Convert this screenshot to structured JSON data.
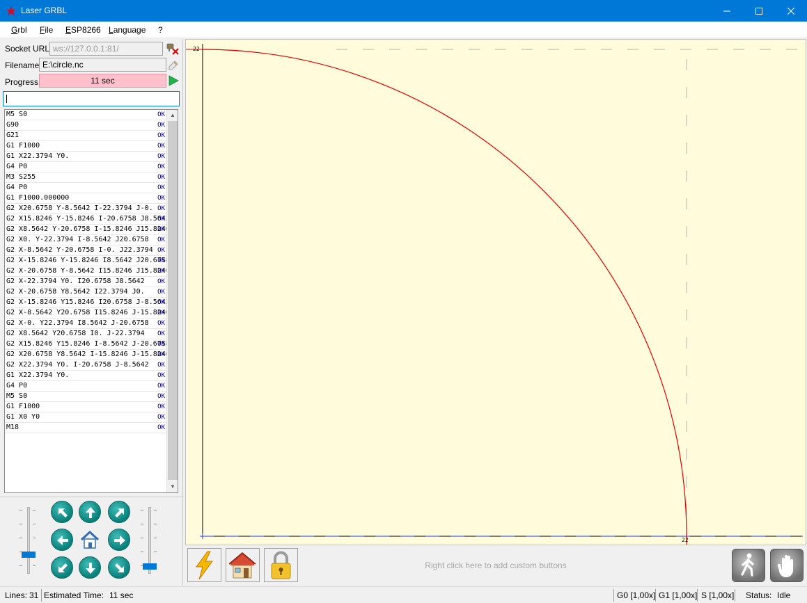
{
  "window": {
    "title": "Laser GRBL",
    "minimize": "—",
    "maximize": "☐",
    "close": "✕"
  },
  "menu": [
    "Grbl",
    "File",
    "ESP8266",
    "Language",
    "?"
  ],
  "left": {
    "socket_label": "Socket URL",
    "socket_value": "ws://127.0.0.1:81/",
    "filename_label": "Filename",
    "filename_value": "E:\\circle.nc",
    "progress_label": "Progress",
    "progress_text": "11 sec",
    "command_value": ""
  },
  "log": [
    {
      "cmd": "M5 S0",
      "status": "OK"
    },
    {
      "cmd": "G90",
      "status": "OK"
    },
    {
      "cmd": "G21",
      "status": "OK"
    },
    {
      "cmd": "G1 F1000",
      "status": "OK"
    },
    {
      "cmd": "G1 X22.3794 Y0.",
      "status": "OK"
    },
    {
      "cmd": "G4 P0",
      "status": "OK"
    },
    {
      "cmd": "M3 S255",
      "status": "OK"
    },
    {
      "cmd": "G4 P0",
      "status": "OK"
    },
    {
      "cmd": "G1 F1000.000000",
      "status": "OK"
    },
    {
      "cmd": "G2 X20.6758 Y-8.5642 I-22.3794 J-0.",
      "status": "OK"
    },
    {
      "cmd": "G2 X15.8246 Y-15.8246 I-20.6758 J8.5642",
      "status": "OK"
    },
    {
      "cmd": "G2 X8.5642 Y-20.6758 I-15.8246 J15.8246",
      "status": "OK"
    },
    {
      "cmd": "G2 X0. Y-22.3794 I-8.5642 J20.6758",
      "status": "OK"
    },
    {
      "cmd": "G2 X-8.5642 Y-20.6758 I-0. J22.3794",
      "status": "OK"
    },
    {
      "cmd": "G2 X-15.8246 Y-15.8246 I8.5642 J20.6758",
      "status": "OK"
    },
    {
      "cmd": "G2 X-20.6758 Y-8.5642 I15.8246 J15.8246",
      "status": "OK"
    },
    {
      "cmd": "G2 X-22.3794 Y0. I20.6758 J8.5642",
      "status": "OK"
    },
    {
      "cmd": "G2 X-20.6758 Y8.5642 I22.3794 J0.",
      "status": "OK"
    },
    {
      "cmd": "G2 X-15.8246 Y15.8246 I20.6758 J-8.5642",
      "status": "OK"
    },
    {
      "cmd": "G2 X-8.5642 Y20.6758 I15.8246 J-15.8246",
      "status": "OK"
    },
    {
      "cmd": "G2 X-0. Y22.3794 I8.5642 J-20.6758",
      "status": "OK"
    },
    {
      "cmd": "G2 X8.5642 Y20.6758 I0. J-22.3794",
      "status": "OK"
    },
    {
      "cmd": "G2 X15.8246 Y15.8246 I-8.5642 J-20.6758",
      "status": "OK"
    },
    {
      "cmd": "G2 X20.6758 Y8.5642 I-15.8246 J-15.8246",
      "status": "OK"
    },
    {
      "cmd": "G2 X22.3794 Y0. I-20.6758 J-8.5642",
      "status": "OK"
    },
    {
      "cmd": "G1 X22.3794 Y0.",
      "status": "OK"
    },
    {
      "cmd": "G4 P0",
      "status": "OK"
    },
    {
      "cmd": "M5 S0",
      "status": "OK"
    },
    {
      "cmd": "G1 F1000",
      "status": "OK"
    },
    {
      "cmd": "G1 X0 Y0",
      "status": "OK"
    },
    {
      "cmd": "M18",
      "status": "OK"
    }
  ],
  "preview": {
    "x_max_label": "22",
    "y_max_label": "22",
    "path_color": "#e00000"
  },
  "bottom": {
    "custom_hint": "Right click here to add custom buttons"
  },
  "status": {
    "lines_label": "Lines:",
    "lines_value": "31",
    "est_label": "Estimated Time:",
    "est_value": "11 sec",
    "g0": "G0 [1,00x]",
    "g1": "G1 [1,00x]",
    "s": "S [1,00x]",
    "status_label": "Status:",
    "status_value": "Idle"
  }
}
